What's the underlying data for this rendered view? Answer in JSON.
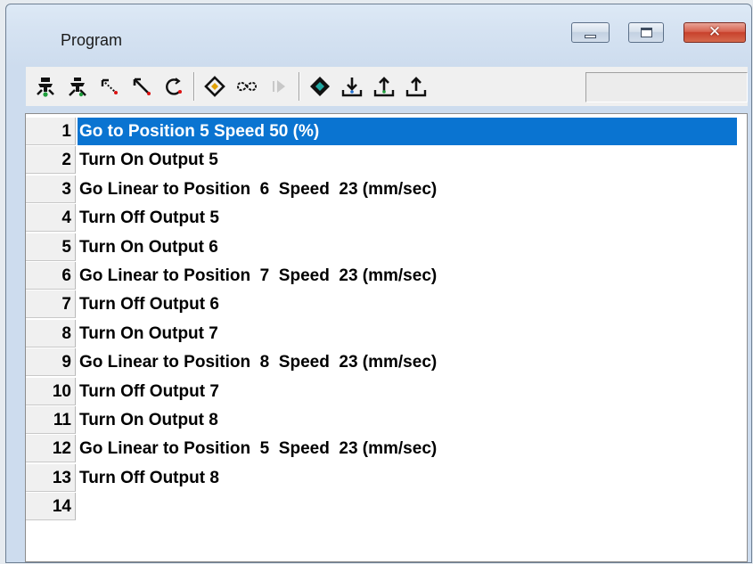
{
  "window": {
    "title": "Program",
    "minimize_icon": "minimize-icon",
    "maximize_icon": "maximize-icon",
    "close_icon": "close-icon",
    "close_glyph": "✕"
  },
  "toolbar": {
    "buttons": [
      {
        "icon": "robot-home-icon"
      },
      {
        "icon": "robot-icon"
      },
      {
        "icon": "arrow-diagonal-dotted-icon"
      },
      {
        "icon": "arrow-diagonal-icon"
      },
      {
        "icon": "circular-arrow-icon"
      },
      {
        "icon": "diamond-point-icon"
      },
      {
        "icon": "loop-icon"
      },
      {
        "icon": "play-disabled-icon"
      },
      {
        "icon": "diamond-target-icon"
      },
      {
        "icon": "download-tray-icon"
      },
      {
        "icon": "upload-tray-icon"
      },
      {
        "icon": "upload-tray-alt-icon"
      }
    ]
  },
  "program": {
    "selected_line": 1,
    "lines": [
      {
        "num": "1",
        "text": "Go to Position 5 Speed 50 (%)"
      },
      {
        "num": "2",
        "text": "Turn On Output 5"
      },
      {
        "num": "3",
        "text": "Go Linear to Position  6  Speed  23 (mm/sec)"
      },
      {
        "num": "4",
        "text": "Turn Off Output 5"
      },
      {
        "num": "5",
        "text": "Turn On Output 6"
      },
      {
        "num": "6",
        "text": "Go Linear to Position  7  Speed  23 (mm/sec)"
      },
      {
        "num": "7",
        "text": "Turn Off Output 6"
      },
      {
        "num": "8",
        "text": "Turn On Output 7"
      },
      {
        "num": "9",
        "text": "Go Linear to Position  8  Speed  23 (mm/sec)"
      },
      {
        "num": "10",
        "text": "Turn Off Output 7"
      },
      {
        "num": "11",
        "text": "Turn On Output 8"
      },
      {
        "num": "12",
        "text": "Go Linear to Position  5  Speed  23 (mm/sec)"
      },
      {
        "num": "13",
        "text": "Turn Off Output 8"
      },
      {
        "num": "14",
        "text": ""
      }
    ]
  },
  "colors": {
    "selection": "#0a74d1",
    "selection_text": "#ffffff",
    "gutter": "#f0f0f0"
  }
}
